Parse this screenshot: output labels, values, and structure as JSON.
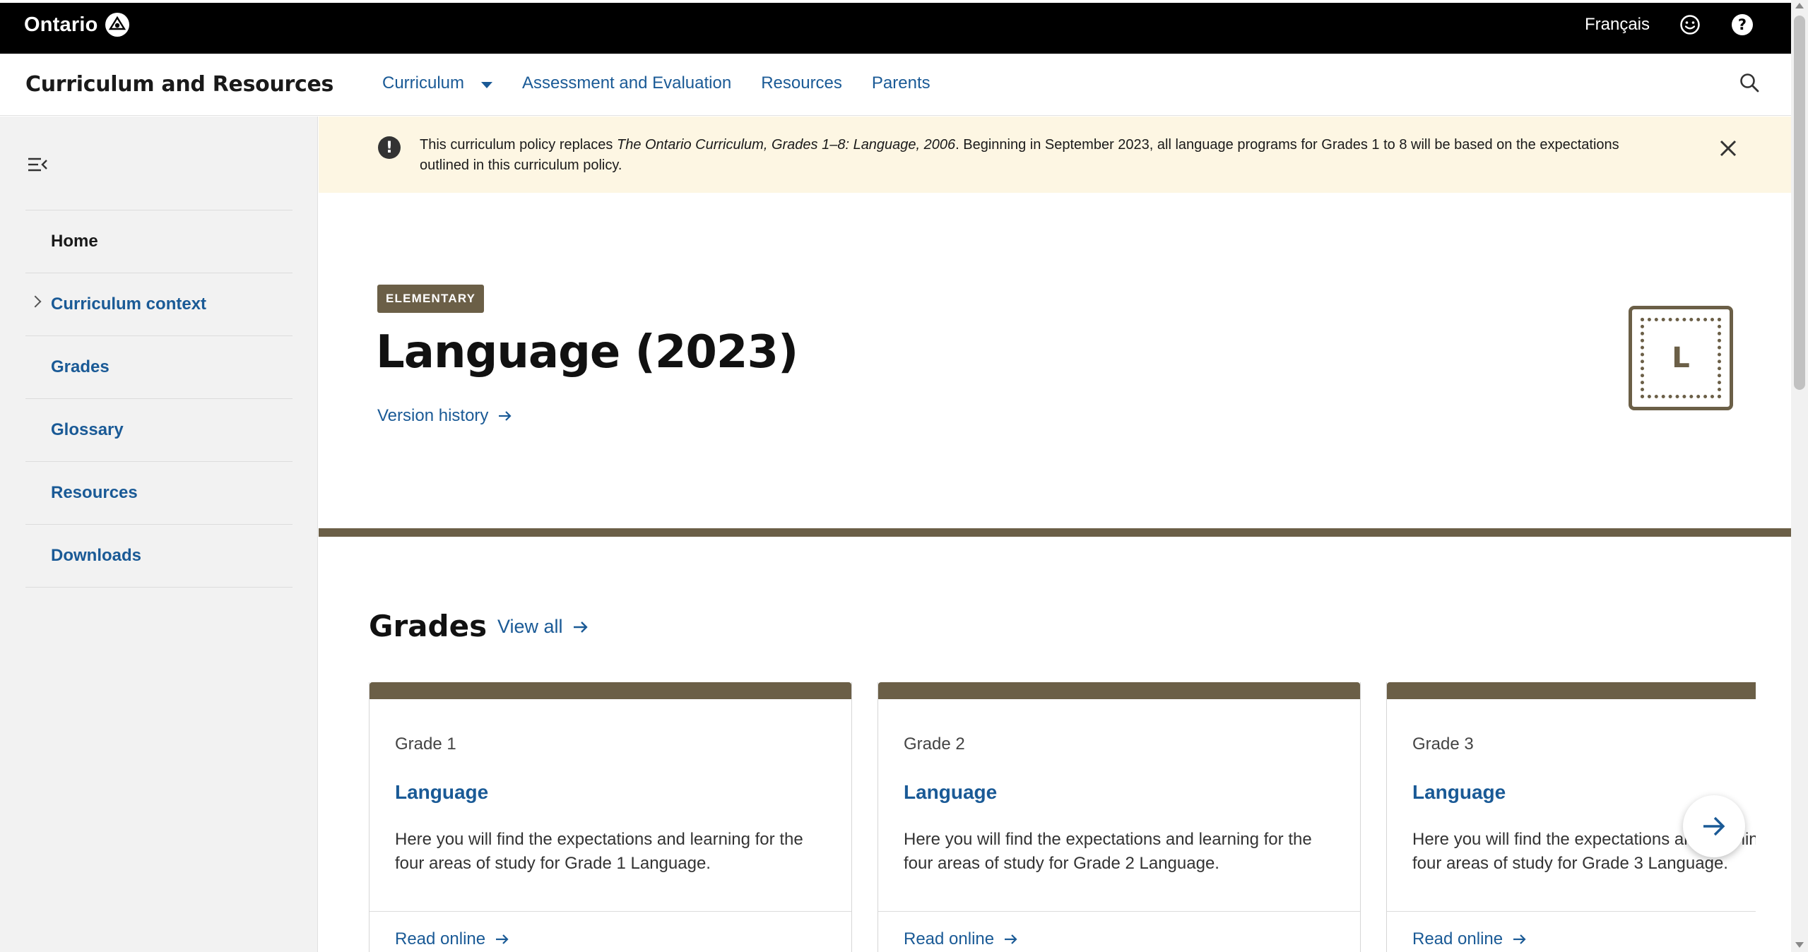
{
  "topbar": {
    "brand": "Ontario",
    "language_link": "Français",
    "feedback_icon": "smiley-icon",
    "help_icon": "help-icon"
  },
  "header": {
    "site_title": "Curriculum and Resources",
    "nav": {
      "curriculum": "Curriculum",
      "assessment": "Assessment and Evaluation",
      "resources": "Resources",
      "parents": "Parents"
    },
    "search_icon": "search-icon"
  },
  "sidebar": {
    "items": [
      {
        "label": "Home"
      },
      {
        "label": "Curriculum context"
      },
      {
        "label": "Grades"
      },
      {
        "label": "Glossary"
      },
      {
        "label": "Resources"
      },
      {
        "label": "Downloads"
      }
    ]
  },
  "banner": {
    "text_before": "This curriculum policy replaces ",
    "text_italic": "The Ontario Curriculum, Grades 1–8: Language, 2006",
    "text_after": ". Beginning in September 2023, all language programs for Grades 1 to 8 will be based on the expectations outlined in this curriculum policy."
  },
  "hero": {
    "badge": "ELEMENTARY",
    "title": "Language (2023)",
    "version_link": "Version history",
    "subject_letter": "L"
  },
  "grades": {
    "title": "Grades",
    "view_all": "View all",
    "cards": [
      {
        "grade": "Grade 1",
        "title": "Language",
        "description": "Here you will find the expectations and learning for the four areas of study for Grade 1 Language.",
        "link": "Read online"
      },
      {
        "grade": "Grade 2",
        "title": "Language",
        "description": "Here you will find the expectations and learning for the four areas of study for Grade 2 Language.",
        "link": "Read online"
      },
      {
        "grade": "Grade 3",
        "title": "Language",
        "description": "Here you will find the expectations and learning for the four areas of study for Grade 3 Language.",
        "link": "Read online"
      }
    ]
  },
  "colors": {
    "accent_brown": "#6b5f47",
    "link_blue": "#1a5a96",
    "banner_bg": "#fdf6e3",
    "topbar_bg": "#000000"
  }
}
